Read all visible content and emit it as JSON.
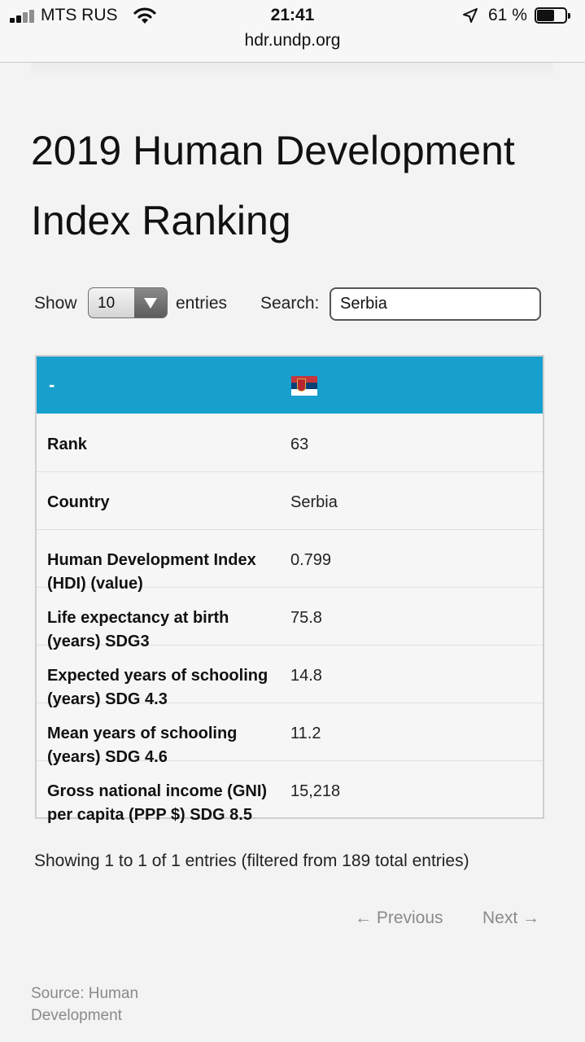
{
  "status_bar": {
    "carrier": "MTS RUS",
    "time": "21:41",
    "battery_percent": "61 %",
    "battery_level": 0.61,
    "url": "hdr.undp.org"
  },
  "page": {
    "title": "2019 Human Development Index Ranking"
  },
  "controls": {
    "show_label": "Show",
    "entries_value": "10",
    "entries_label": "entries",
    "search_label": "Search:",
    "search_value": "Serbia"
  },
  "table": {
    "header_label": "-",
    "flag_icon": "serbia-flag-icon",
    "flag_colors": [
      "#c6363c",
      "#0c4076",
      "#ffffff"
    ],
    "rows": [
      {
        "label": "Rank",
        "value": "63"
      },
      {
        "label": "Country",
        "value": "Serbia"
      },
      {
        "label": "Human Development Index (HDI)  (value)",
        "value": "0.799"
      },
      {
        "label": "Life expectancy at birth (years) SDG3",
        "value": "75.8"
      },
      {
        "label": "Expected years of schooling (years) SDG 4.3",
        "value": "14.8"
      },
      {
        "label": "Mean years of schooling (years) SDG 4.6",
        "value": "11.2"
      },
      {
        "label": "Gross national income (GNI) per capita (PPP $) SDG 8.5",
        "value": "15,218"
      }
    ]
  },
  "table_info": "Showing 1 to 1 of 1 entries (filtered from 189 total entries)",
  "pagination": {
    "previous": "← Previous",
    "next": "Next →"
  },
  "source_text": "Source: Human Development",
  "colors": {
    "header_blue": "#179fce",
    "page_background": "#f3f3f3",
    "link_gray": "#8a8a8a"
  }
}
